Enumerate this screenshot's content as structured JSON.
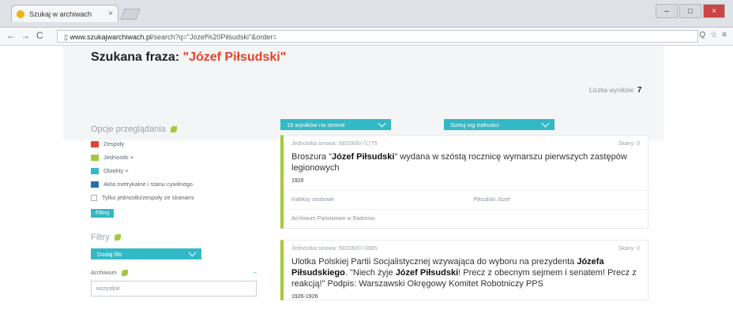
{
  "browser": {
    "tab_title": "Szukaj w archiwach",
    "tab_close": "×",
    "url_domain": "www.szukajwarchiwach.pl",
    "url_path": "/search?q=\"Józef%20Piłsudski\"&order=",
    "back": "←",
    "forward": "→",
    "reload": "C",
    "page_icon": "▯",
    "window_minimize": "–",
    "window_maximize": "□",
    "window_close": "×",
    "omni_search": "Q",
    "omni_star": "☆",
    "omni_menu": "≡"
  },
  "header": {
    "label": "Szukana fraza:",
    "query": "\"Józef Piłsudski\"",
    "results_label": "Liczba wyników:",
    "results_count": "7"
  },
  "sidebar": {
    "options_heading": "Opcje przeglądania",
    "options": [
      {
        "label": "Zespoły",
        "color": "#e4432a"
      },
      {
        "label": "Jednostki +",
        "color": "#a5c83a"
      },
      {
        "label": "Obiekty +",
        "color": "#33b9c6"
      },
      {
        "label": "Akta metrykalne i stanu cywilnego",
        "color": "#2a6fa8"
      }
    ],
    "only_with_scans": "Tylko jednostki/zespoły ze skanami",
    "filter_button": "Filtruj",
    "filters_heading": "Filtry",
    "add_filter": "Dodaj filtr",
    "archives_label": "Archiwum",
    "archives_value": "wszystkie",
    "collapse": "–"
  },
  "toolbar": {
    "per_page": "15 wyników na stronie",
    "sort": "Sortuj wg trafności"
  },
  "results": [
    {
      "code": "Jednostka sinowa: 58/206/0/-/1775",
      "scans": "Skany: 0",
      "title_parts": [
        "Broszura \"",
        "Józef Piłsudski",
        "\" wydana w szóstą rocznicę wymarszu pierwszych zastępów legionowych"
      ],
      "date": "1920",
      "meta_left": "Indeksy osobowe",
      "meta_right": "Piłsudski Józef",
      "archive": "Archiwum Państwowe w Radomiu"
    },
    {
      "code": "Jednostka sinowa: 58/206/0/-/3965",
      "scans": "Skany: 0",
      "title_parts": [
        "Ulotka Polskiej Partii Socjalistycznej wzywająca do wyboru na prezydenta ",
        "Józefa Piłsudskiego",
        ". \"Niech żyje ",
        "Józef Piłsudski",
        "! Precz z obecnym sejmem i senatem! Precz z reakcją!\" Podpis: Warszawski Okręgowy Komitet Robotniczy PPS"
      ],
      "date": "1926-1926"
    }
  ]
}
